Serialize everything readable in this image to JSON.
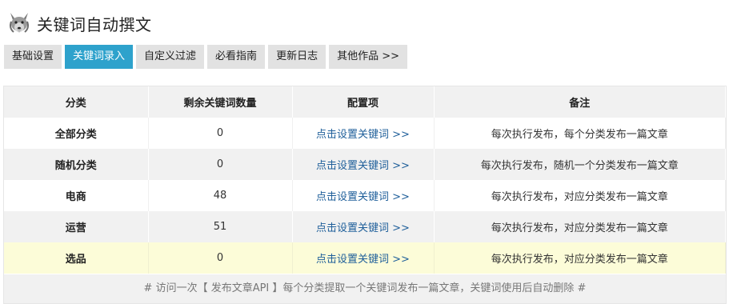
{
  "header": {
    "title": "关键词自动撰文",
    "logo_icon": "wolf-logo-icon"
  },
  "tabs": [
    {
      "label": "基础设置",
      "active": false
    },
    {
      "label": "关键词录入",
      "active": true
    },
    {
      "label": "自定义过滤",
      "active": false
    },
    {
      "label": "必看指南",
      "active": false
    },
    {
      "label": "更新日志",
      "active": false
    },
    {
      "label": "其他作品 >>",
      "active": false
    }
  ],
  "colors": {
    "active_tab": "#2ea2cc",
    "tab_bg": "#e2e2e2",
    "link": "#1f5f9a",
    "highlight_row": "#fcfcd8"
  },
  "table": {
    "headers": [
      "分类",
      "剩余关键词数量",
      "配置项",
      "备注"
    ],
    "rows": [
      {
        "category": "全部分类",
        "count": "0",
        "action": "点击设置关键词 >>",
        "note": "每次执行发布，每个分类发布一篇文章"
      },
      {
        "category": "随机分类",
        "count": "0",
        "action": "点击设置关键词 >>",
        "note": "每次执行发布，随机一个分类发布一篇文章"
      },
      {
        "category": "电商",
        "count": "48",
        "action": "点击设置关键词 >>",
        "note": "每次执行发布，对应分类发布一篇文章"
      },
      {
        "category": "运营",
        "count": "51",
        "action": "点击设置关键词 >>",
        "note": "每次执行发布，对应分类发布一篇文章"
      },
      {
        "category": "选品",
        "count": "0",
        "action": "点击设置关键词 >>",
        "note": "每次执行发布，对应分类发布一篇文章"
      }
    ],
    "footnote": "# 访问一次【 发布文章API 】每个分类提取一个关键词发布一篇文章，关键词使用后自动删除 #"
  }
}
